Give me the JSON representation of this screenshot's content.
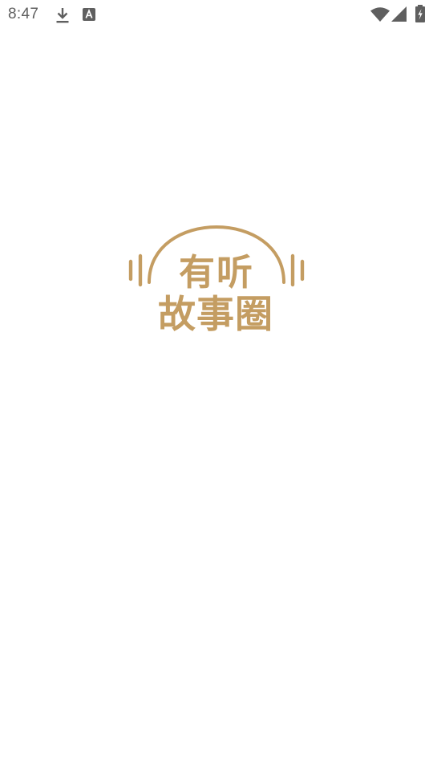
{
  "status_bar": {
    "time": "8:47",
    "left_icons": [
      "download-icon",
      "app-notification-icon"
    ],
    "right_icons": [
      "wifi-icon",
      "cell-signal-icon",
      "battery-charging-icon"
    ]
  },
  "splash": {
    "logo_line_1": "有听",
    "logo_line_2": "故事圈",
    "brand_color": "#c49d62"
  },
  "colors": {
    "background": "#ffffff",
    "status_icons": "#5f5f5f"
  }
}
